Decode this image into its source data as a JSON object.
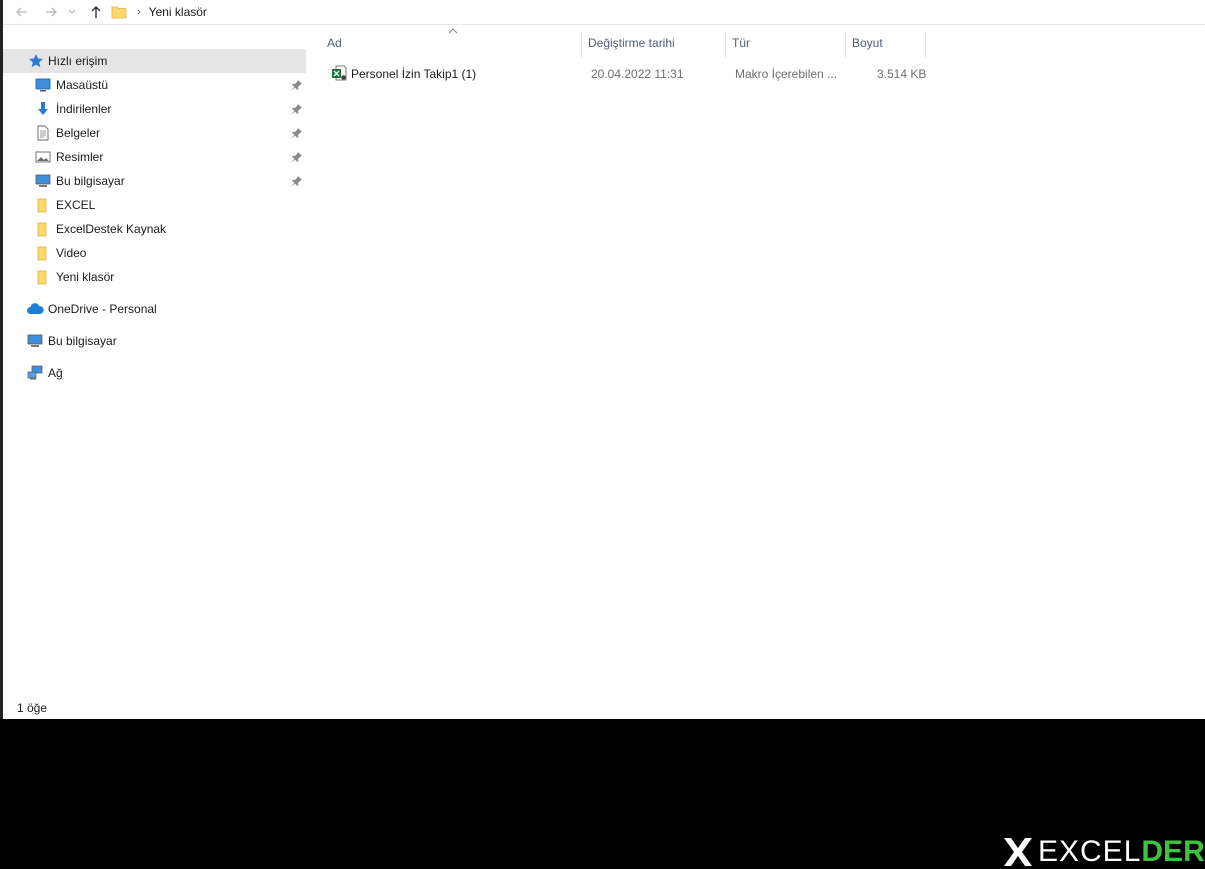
{
  "addressbar": {
    "back_icon": "arrow-left-icon",
    "forward_icon": "arrow-right-icon",
    "recent_icon": "chevron-down-icon",
    "up_icon": "arrow-up-icon",
    "breadcrumb_separator": "›",
    "breadcrumb_current": "Yeni klasör"
  },
  "sidebar": {
    "items": [
      {
        "label": "Hızlı erişim",
        "icon": "star-icon",
        "pinned": false,
        "selected": true
      },
      {
        "label": "Masaüstü",
        "icon": "desktop-icon",
        "pinned": true
      },
      {
        "label": "İndirilenler",
        "icon": "download-icon",
        "pinned": true
      },
      {
        "label": "Belgeler",
        "icon": "document-icon",
        "pinned": true
      },
      {
        "label": "Resimler",
        "icon": "pictures-icon",
        "pinned": true
      },
      {
        "label": "Bu bilgisayar",
        "icon": "computer-icon",
        "pinned": true
      },
      {
        "label": "EXCEL",
        "icon": "folder-icon",
        "pinned": false
      },
      {
        "label": "ExcelDestek Kaynak",
        "icon": "folder-icon",
        "pinned": false
      },
      {
        "label": "Video",
        "icon": "folder-icon",
        "pinned": false
      },
      {
        "label": "Yeni klasör",
        "icon": "folder-icon",
        "pinned": false
      },
      {
        "label": "OneDrive - Personal",
        "icon": "cloud-icon",
        "pinned": false
      },
      {
        "label": "Bu bilgisayar",
        "icon": "computer-icon",
        "pinned": false
      },
      {
        "label": "Ağ",
        "icon": "network-icon",
        "pinned": false
      }
    ]
  },
  "filelist": {
    "columns": [
      "Ad",
      "Değiştirme tarihi",
      "Tür",
      "Boyut"
    ],
    "rows": [
      {
        "name": "Personel İzin Takip1 (1)",
        "modified": "20.04.2022 11:31",
        "type": "Makro İçerebilen ...",
        "size": "3.514 KB",
        "icon": "excel-macro-file-icon"
      }
    ]
  },
  "statusbar": {
    "item_count": "1 öğe"
  },
  "watermark": {
    "text_a": "EXCEL",
    "text_b": "DERS"
  },
  "colors": {
    "selection": "#e5e5e5",
    "header_text": "#4c607a",
    "folder": "#ffd86b",
    "watermark_green": "#3cc43c"
  }
}
